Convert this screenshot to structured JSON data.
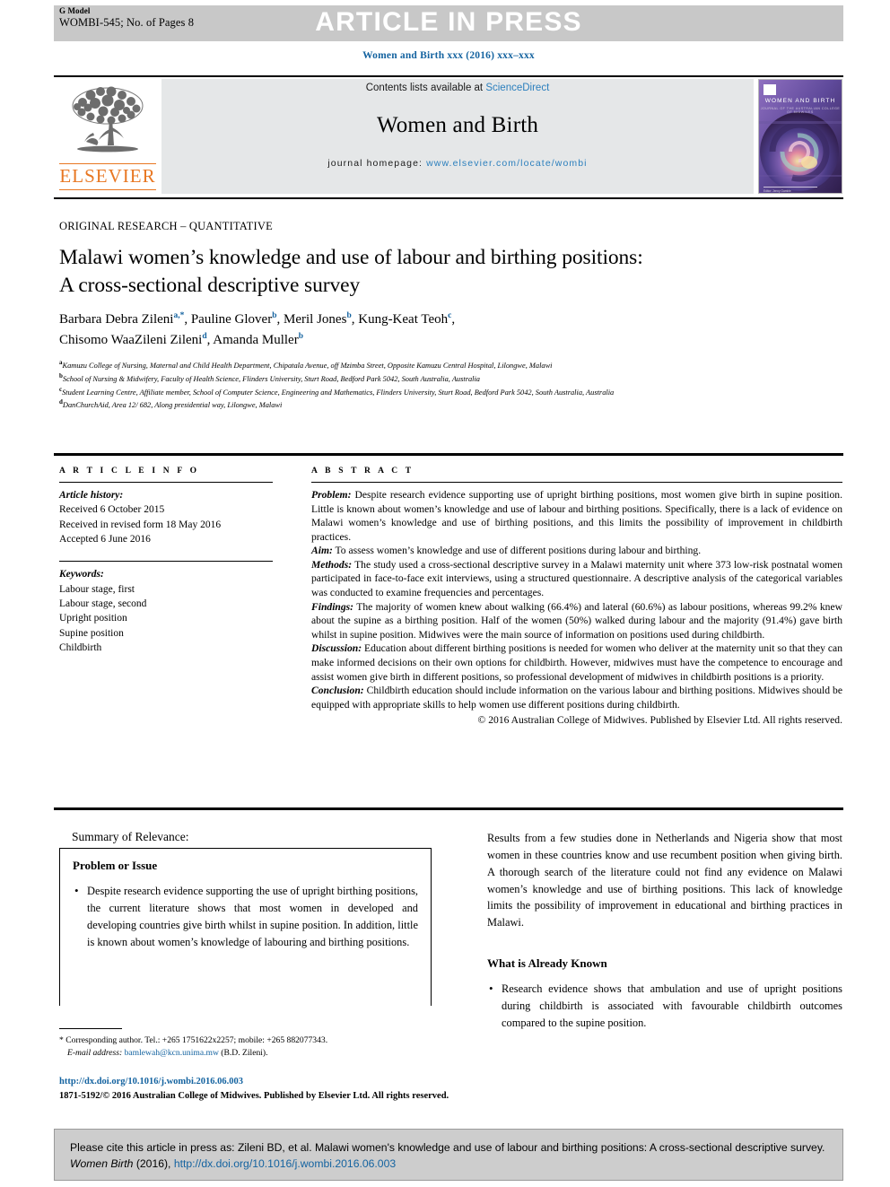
{
  "header": {
    "gmodel_label": "G Model",
    "article_id": "WOMBI-545; No. of Pages 8",
    "article_in_press": "ARTICLE IN PRESS",
    "journal_citation_line": "Women and Birth xxx (2016) xxx–xxx"
  },
  "masthead": {
    "contents_prefix": "Contents lists available at ",
    "contents_link": "ScienceDirect",
    "journal_title": "Women and Birth",
    "homepage_prefix": "journal homepage: ",
    "homepage_link": "www.elsevier.com/locate/wombi",
    "publisher_logo_text": "ELSEVIER",
    "cover_title": "WOMEN AND BIRTH",
    "cover_subtitle": "JOURNAL OF THE AUSTRALIAN COLLEGE OF MIDWIVES",
    "cover_footer": "Editor: Jenny Gamble"
  },
  "article": {
    "section_label": "ORIGINAL RESEARCH – QUANTITATIVE",
    "title_line1": "Malawi women’s knowledge and use of labour and birthing positions:",
    "title_line2": "A cross-sectional descriptive survey",
    "authors_line1": "Barbara Debra Zileni",
    "authors_line1_sup1": "a,*",
    "authors_line1_b": ", Pauline Glover",
    "authors_line1_sup2": "b",
    "authors_line1_c": ", Meril Jones",
    "authors_line1_sup3": "b",
    "authors_line1_d": ", Kung-Keat Teoh",
    "authors_line1_sup4": "c",
    "authors_line1_e": ",",
    "authors_line2": "Chisomo WaaZileni Zileni",
    "authors_line2_sup1": "d",
    "authors_line2_b": ", Amanda Muller",
    "authors_line2_sup2": "b",
    "affiliations": [
      {
        "marker": "a",
        "text": "Kamuzu College of Nursing, Maternal and Child Health Department, Chipatala Avenue, off Mzimba Street, Opposite Kamuzu Central Hospital, Lilongwe, Malawi"
      },
      {
        "marker": "b",
        "text": "School of Nursing & Midwifery, Faculty of Health Science, Flinders University, Sturt Road, Bedford Park 5042, South Australia, Australia"
      },
      {
        "marker": "c",
        "text": "Student Learning Centre, Affiliate member, School of Computer Science, Engineering and Mathematics, Flinders University, Sturt Road, Bedford Park 5042, South Australia, Australia"
      },
      {
        "marker": "d",
        "text": "DanChurchAid, Area 12/ 682, Along presidential way, Lilongwe, Malawi"
      }
    ]
  },
  "article_info": {
    "heading": "A R T I C L E  I N F O",
    "history_label": "Article history:",
    "history": [
      "Received 6 October 2015",
      "Received in revised form 18 May 2016",
      "Accepted 6 June 2016"
    ],
    "keywords_label": "Keywords:",
    "keywords": [
      "Labour stage, first",
      "Labour stage, second",
      "Upright position",
      "Supine position",
      "Childbirth"
    ]
  },
  "abstract": {
    "heading": "A B S T R A C T",
    "sections": [
      {
        "lead": "Problem:",
        "text": " Despite research evidence supporting use of upright birthing positions, most women give birth in supine position. Little is known about women’s knowledge and use of labour and birthing positions. Specifically, there is a lack of evidence on Malawi women’s knowledge and use of birthing positions, and this limits the possibility of improvement in childbirth practices."
      },
      {
        "lead": "Aim:",
        "text": " To assess women’s knowledge and use of different positions during labour and birthing."
      },
      {
        "lead": "Methods:",
        "text": " The study used a cross-sectional descriptive survey in a Malawi maternity unit where 373 low-risk postnatal women participated in face-to-face exit interviews, using a structured questionnaire. A descriptive analysis of the categorical variables was conducted to examine frequencies and percentages."
      },
      {
        "lead": "Findings:",
        "text": " The majority of women knew about walking (66.4%) and lateral (60.6%) as labour positions, whereas 99.2% knew about the supine as a birthing position. Half of the women (50%) walked during labour and the majority (91.4%) gave birth whilst in supine position. Midwives were the main source of information on positions used during childbirth."
      },
      {
        "lead": "Discussion:",
        "text": " Education about different birthing positions is needed for women who deliver at the maternity unit so that they can make informed decisions on their own options for childbirth. However, midwives must have the competence to encourage and assist women give birth in different positions, so professional development of midwives in childbirth positions is a priority."
      },
      {
        "lead": "Conclusion:",
        "text": " Childbirth education should include information on the various labour and birthing positions. Midwives should be equipped with appropriate skills to help women use different positions during childbirth."
      }
    ],
    "copyright": "© 2016 Australian College of Midwives. Published by Elsevier Ltd. All rights reserved."
  },
  "body": {
    "summary_label": "Summary of Relevance:",
    "problem_heading": "Problem or Issue",
    "problem_bullet": "Despite research evidence supporting the use of upright birthing positions, the current literature shows that most women in developed and developing countries give birth whilst in supine position. In addition, little is known about women’s knowledge of labouring and birthing positions.",
    "right_paragraph": "Results from a few studies done in Netherlands and Nigeria show that most women in these countries know and use recumbent position when giving birth. A thorough search of the literature could not find any evidence on Malawi women’s knowledge and use of birthing positions. This lack of knowledge limits the possibility of improvement in educational and birthing practices in Malawi.",
    "already_known_heading": "What is Already Known",
    "already_known_bullet": "Research evidence shows that ambulation and use of upright positions during childbirth is associated with favourable childbirth outcomes compared to the supine position."
  },
  "footnote": {
    "corresponding": "* Corresponding author. Tel.: +265 1751622x2257; mobile: +265 882077343.",
    "email_label": "E-mail address:",
    "email": "bamlewah@kcn.unima.mw",
    "email_owner": "(B.D. Zileni)."
  },
  "doi_block": {
    "doi_url": "http://dx.doi.org/10.1016/j.wombi.2016.06.003",
    "issn_line": "1871-5192/© 2016 Australian College of Midwives. Published by Elsevier Ltd. All rights reserved."
  },
  "cite_footer": {
    "text_a": "Please cite this article in press as: Zileni BD, et al. Malawi women's knowledge and use of labour and birthing positions: A cross-sectional descriptive survey. ",
    "journal": "Women Birth",
    "text_b": " (2016), ",
    "link": "http://dx.doi.org/10.1016/j.wombi.2016.06.003"
  },
  "colors": {
    "link_blue": "#1463a0",
    "sciencedirect_blue": "#2b7fbd",
    "elsevier_orange": "#e87722",
    "banner_grey": "#c8c8c8",
    "masthead_grey": "#e5e7e8",
    "cite_grey": "#cdcdcd"
  }
}
